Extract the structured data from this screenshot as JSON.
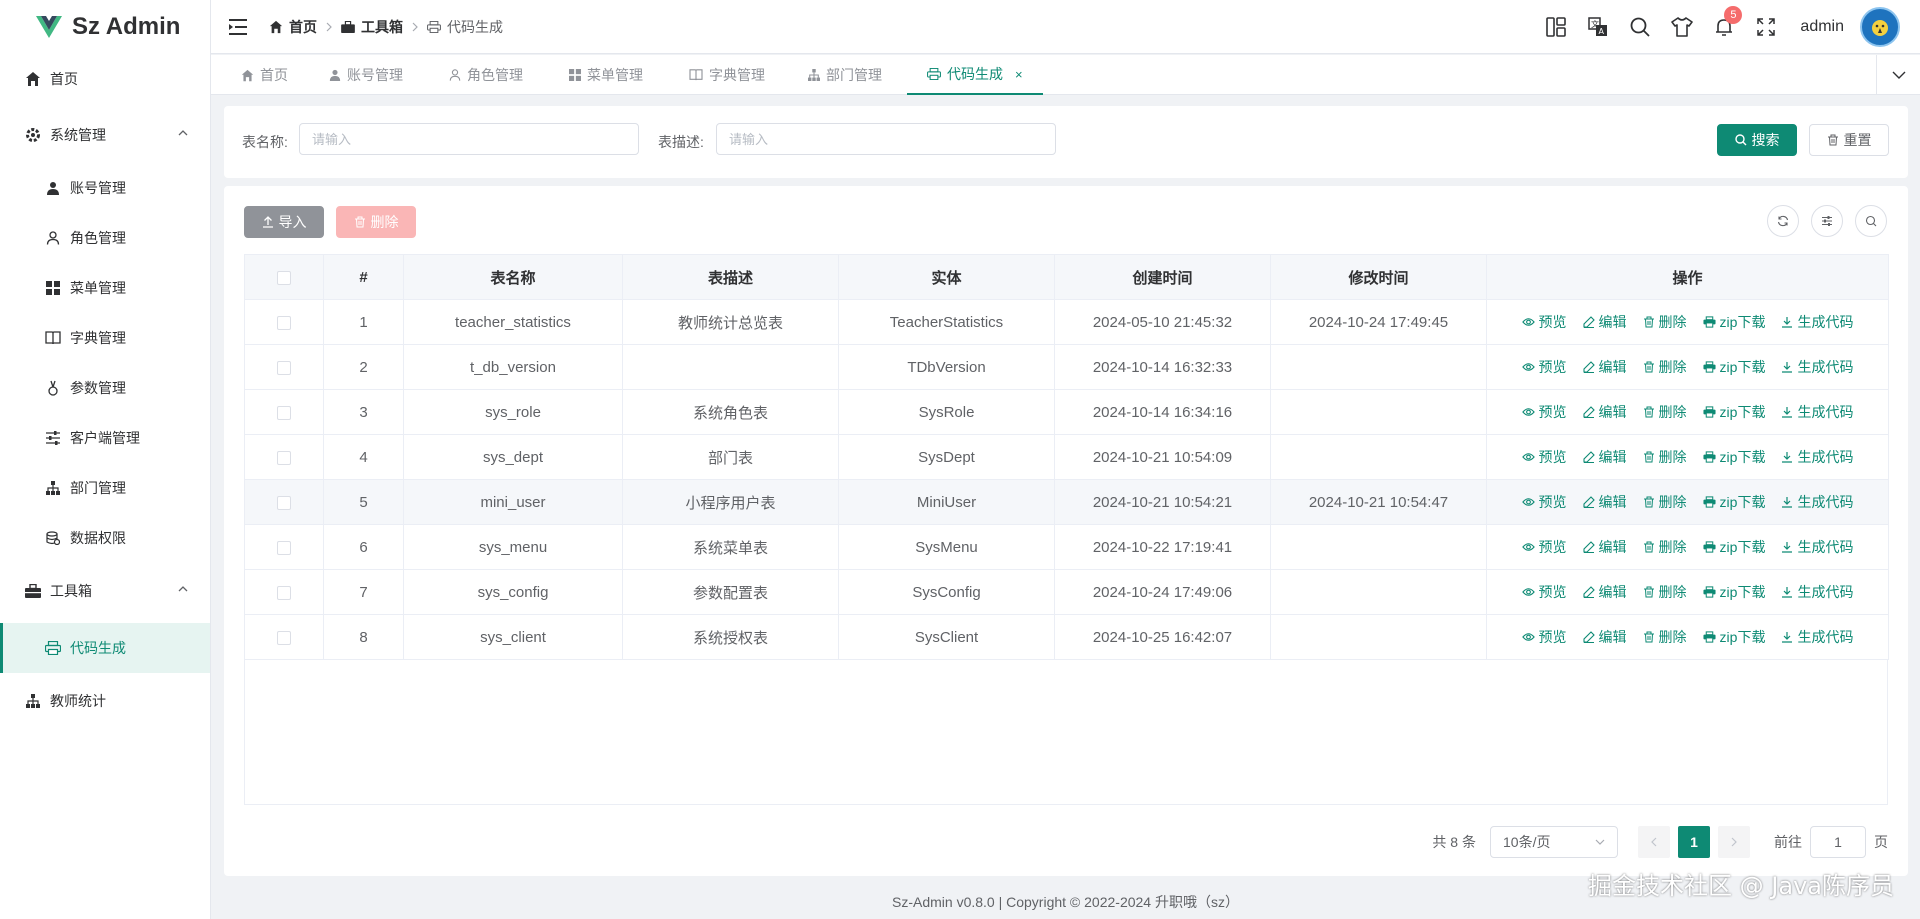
{
  "app": {
    "logo_text": "Sz Admin"
  },
  "sidebar": {
    "items": [
      {
        "label": "首页",
        "icon": "home-icon"
      },
      {
        "label": "系统管理",
        "icon": "gear-icon",
        "expanded": true
      },
      {
        "label": "账号管理",
        "icon": "user-icon"
      },
      {
        "label": "角色管理",
        "icon": "user-outline-icon"
      },
      {
        "label": "菜单管理",
        "icon": "grid-icon"
      },
      {
        "label": "字典管理",
        "icon": "book-icon"
      },
      {
        "label": "参数管理",
        "icon": "param-icon"
      },
      {
        "label": "客户端管理",
        "icon": "sliders-icon"
      },
      {
        "label": "部门管理",
        "icon": "org-icon"
      },
      {
        "label": "数据权限",
        "icon": "data-icon"
      },
      {
        "label": "工具箱",
        "icon": "toolbox-icon",
        "expanded": true
      },
      {
        "label": "代码生成",
        "icon": "printer-icon",
        "active": true
      },
      {
        "label": "教师统计",
        "icon": "org-icon"
      }
    ]
  },
  "header": {
    "breadcrumb": [
      "首页",
      "工具箱",
      "代码生成"
    ],
    "badge_count": "5",
    "username": "admin"
  },
  "tabs": [
    {
      "label": "首页",
      "icon": "home-icon"
    },
    {
      "label": "账号管理",
      "icon": "user-icon"
    },
    {
      "label": "角色管理",
      "icon": "user-outline-icon"
    },
    {
      "label": "菜单管理",
      "icon": "grid-icon"
    },
    {
      "label": "字典管理",
      "icon": "book-icon"
    },
    {
      "label": "部门管理",
      "icon": "org-icon"
    },
    {
      "label": "代码生成",
      "icon": "printer-icon",
      "active": true,
      "close": "×"
    }
  ],
  "search": {
    "table_name_label": "表名称:",
    "table_name_placeholder": "请输入",
    "table_desc_label": "表描述:",
    "table_desc_placeholder": "请输入",
    "search_button": "搜索",
    "reset_button": "重置"
  },
  "toolbar": {
    "import_button": "导入",
    "delete_button": "删除"
  },
  "table": {
    "columns": [
      "#",
      "表名称",
      "表描述",
      "实体",
      "创建时间",
      "修改时间",
      "操作"
    ],
    "rows": [
      {
        "index": "1",
        "name": "teacher_statistics",
        "desc": "教师统计总览表",
        "entity": "TeacherStatistics",
        "created": "2024-05-10 21:45:32",
        "updated": "2024-10-24 17:49:45"
      },
      {
        "index": "2",
        "name": "t_db_version",
        "desc": "",
        "entity": "TDbVersion",
        "created": "2024-10-14 16:32:33",
        "updated": ""
      },
      {
        "index": "3",
        "name": "sys_role",
        "desc": "系统角色表",
        "entity": "SysRole",
        "created": "2024-10-14 16:34:16",
        "updated": ""
      },
      {
        "index": "4",
        "name": "sys_dept",
        "desc": "部门表",
        "entity": "SysDept",
        "created": "2024-10-21 10:54:09",
        "updated": ""
      },
      {
        "index": "5",
        "name": "mini_user",
        "desc": "小程序用户表",
        "entity": "MiniUser",
        "created": "2024-10-21 10:54:21",
        "updated": "2024-10-21 10:54:47"
      },
      {
        "index": "6",
        "name": "sys_menu",
        "desc": "系统菜单表",
        "entity": "SysMenu",
        "created": "2024-10-22 17:19:41",
        "updated": ""
      },
      {
        "index": "7",
        "name": "sys_config",
        "desc": "参数配置表",
        "entity": "SysConfig",
        "created": "2024-10-24 17:49:06",
        "updated": ""
      },
      {
        "index": "8",
        "name": "sys_client",
        "desc": "系统授权表",
        "entity": "SysClient",
        "created": "2024-10-25 16:42:07",
        "updated": ""
      }
    ],
    "row_actions": [
      "预览",
      "编辑",
      "删除",
      "zip下载",
      "生成代码"
    ]
  },
  "pagination": {
    "total": "共 8 条",
    "page_size": "10条/页",
    "current_page": "1",
    "goto_prefix": "前往",
    "goto_value": "1",
    "goto_suffix": "页"
  },
  "footer": {
    "text": "Sz-Admin v0.8.0 | Copyright © 2022-2024 升职哦（sz）"
  },
  "watermark": "掘金技术社区 @ Java陈序员",
  "colors": {
    "primary": "#0e8a74",
    "danger_badge": "#f56c6c",
    "info_button": "#909399",
    "disabled_danger": "#fab6b6"
  }
}
